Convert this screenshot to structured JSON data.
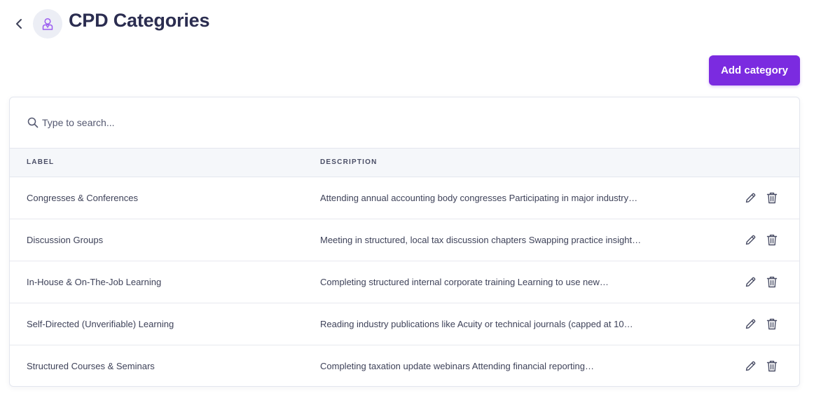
{
  "header": {
    "title": "CPD Categories",
    "back_icon": "chevron-left-icon",
    "page_icon": "user-badge-icon"
  },
  "toolbar": {
    "add_label": "Add category"
  },
  "search": {
    "placeholder": "Type to search...",
    "value": ""
  },
  "table": {
    "columns": [
      "LABEL",
      "DESCRIPTION"
    ],
    "rows": [
      {
        "label": "Congresses & Conferences",
        "description": "Attending annual accounting body congresses Participating in major industry…"
      },
      {
        "label": "Discussion Groups",
        "description": "Meeting in structured, local tax discussion chapters Swapping practice insights…"
      },
      {
        "label": "In-House & On-The-Job Learning",
        "description": "Completing structured internal corporate training Learning to use new…"
      },
      {
        "label": "Self-Directed (Unverifiable) Learning",
        "description": "Reading industry publications like Acuity or technical journals (capped at 10…"
      },
      {
        "label": "Structured Courses & Seminars",
        "description": "Completing taxation update webinars Attending financial reporting…"
      }
    ],
    "row_actions": [
      "pencil-icon",
      "trash-icon"
    ]
  },
  "colors": {
    "accent": "#7b2be0",
    "title": "#2b2d50",
    "header_bg": "#f5f7fa"
  }
}
